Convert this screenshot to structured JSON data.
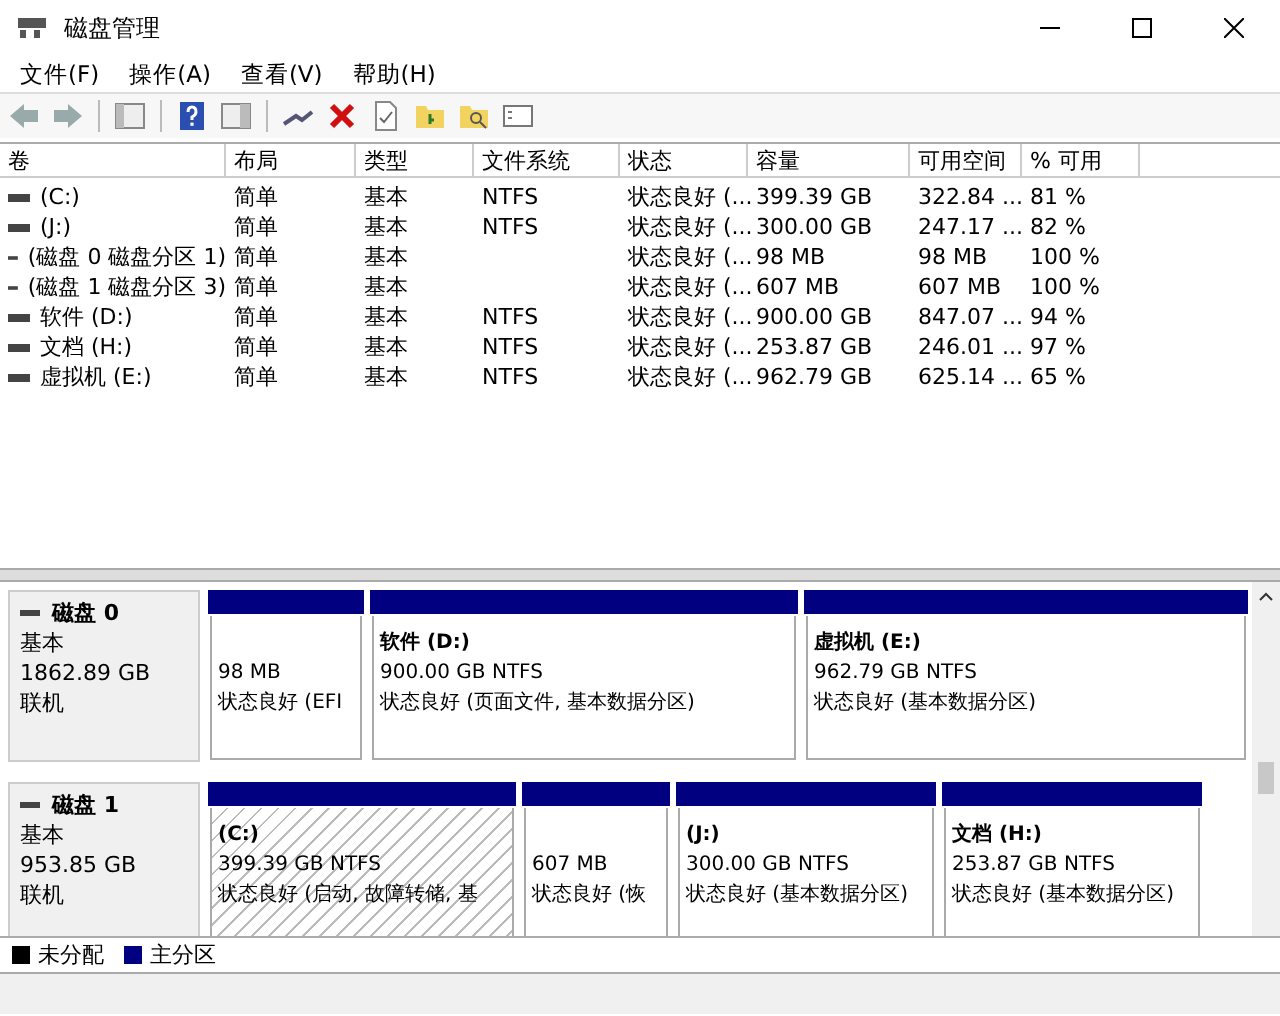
{
  "window": {
    "title": "磁盘管理"
  },
  "menu": [
    "文件(F)",
    "操作(A)",
    "查看(V)",
    "帮助(H)"
  ],
  "table": {
    "columns": [
      "卷",
      "布局",
      "类型",
      "文件系统",
      "状态",
      "容量",
      "可用空间",
      "% 可用"
    ],
    "rows": [
      [
        "(C:)",
        "简单",
        "基本",
        "NTFS",
        "状态良好 (...",
        "399.39 GB",
        "322.84 ...",
        "81 %"
      ],
      [
        "(J:)",
        "简单",
        "基本",
        "NTFS",
        "状态良好 (...",
        "300.00 GB",
        "247.17 ...",
        "82 %"
      ],
      [
        "(磁盘 0 磁盘分区 1)",
        "简单",
        "基本",
        "",
        "状态良好 (...",
        "98 MB",
        "98 MB",
        "100 %"
      ],
      [
        "(磁盘 1 磁盘分区 3)",
        "简单",
        "基本",
        "",
        "状态良好 (...",
        "607 MB",
        "607 MB",
        "100 %"
      ],
      [
        "软件 (D:)",
        "简单",
        "基本",
        "NTFS",
        "状态良好 (...",
        "900.00 GB",
        "847.07 ...",
        "94 %"
      ],
      [
        "文档 (H:)",
        "简单",
        "基本",
        "NTFS",
        "状态良好 (...",
        "253.87 GB",
        "246.01 ...",
        "97 %"
      ],
      [
        "虚拟机 (E:)",
        "简单",
        "基本",
        "NTFS",
        "状态良好 (...",
        "962.79 GB",
        "625.14 ...",
        "65 %"
      ]
    ]
  },
  "disks": [
    {
      "name": "磁盘 0",
      "type": "基本",
      "size": "1862.89 GB",
      "status": "联机",
      "partitions": [
        {
          "kind": "primary",
          "selected": false,
          "size_fs": "98 MB",
          "status": "状态良好 (EFI"
        },
        {
          "kind": "primary",
          "selected": false,
          "name": "软件 (D:)",
          "size_fs": "900.00 GB NTFS",
          "status": "状态良好 (页面文件, 基本数据分区)"
        },
        {
          "kind": "primary",
          "selected": false,
          "name": "虚拟机 (E:)",
          "size_fs": "962.79 GB NTFS",
          "status": "状态良好 (基本数据分区)"
        }
      ]
    },
    {
      "name": "磁盘 1",
      "type": "基本",
      "size": "953.85 GB",
      "status": "联机",
      "partitions": [
        {
          "kind": "primary",
          "selected": true,
          "name": "(C:)",
          "size_fs": "399.39 GB NTFS",
          "status": "状态良好 (启动, 故障转储, 基"
        },
        {
          "kind": "primary",
          "selected": false,
          "size_fs": "607 MB",
          "status": "状态良好 (恢"
        },
        {
          "kind": "primary",
          "selected": false,
          "name": "(J:)",
          "size_fs": "300.00 GB NTFS",
          "status": "状态良好 (基本数据分区)"
        },
        {
          "kind": "primary",
          "selected": false,
          "name": "文档 (H:)",
          "size_fs": "253.87 GB NTFS",
          "status": "状态良好 (基本数据分区)"
        }
      ]
    }
  ],
  "legend": [
    {
      "label": "未分配",
      "color": "#000000"
    },
    {
      "label": "主分区",
      "color": "#000080"
    }
  ]
}
